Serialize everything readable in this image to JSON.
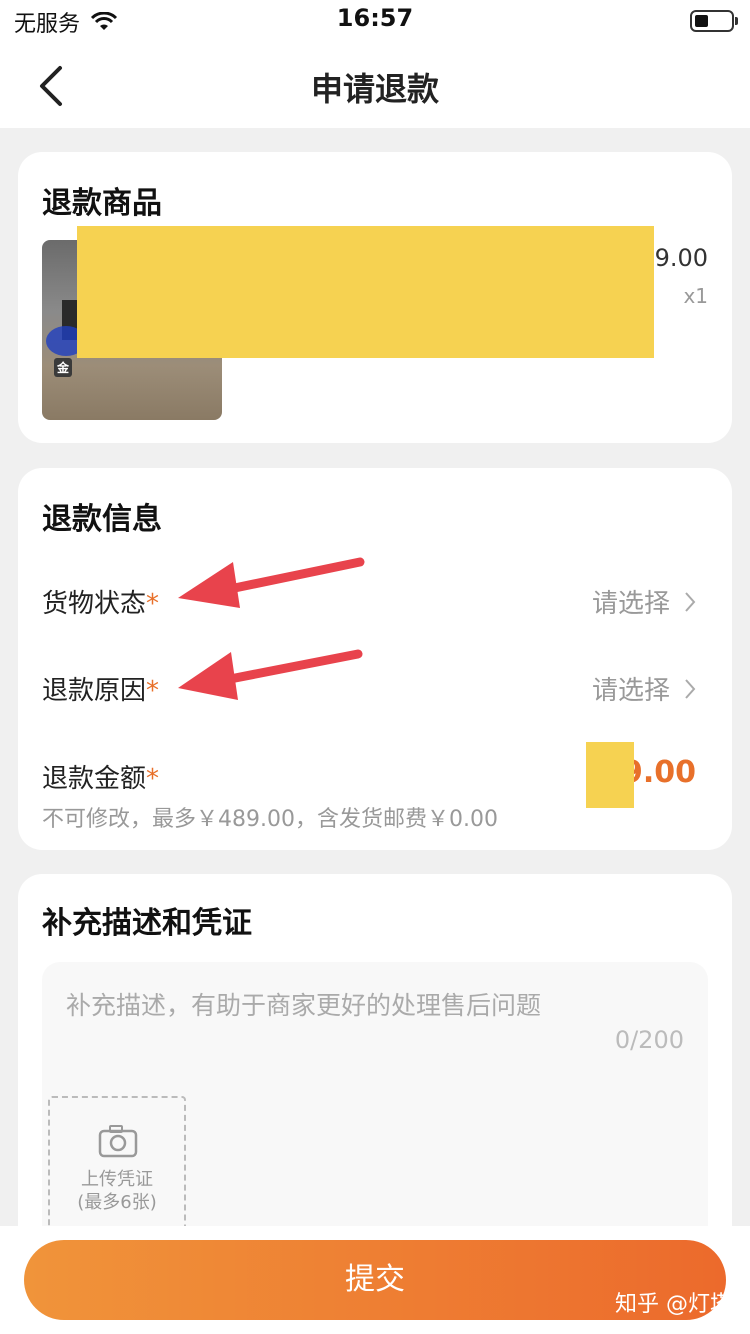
{
  "status_bar": {
    "carrier": "无服务",
    "time": "16:57"
  },
  "nav": {
    "title": "申请退款"
  },
  "product_card": {
    "title": "退款商品",
    "price": "9.00",
    "quantity": "x1"
  },
  "info_card": {
    "title": "退款信息",
    "goods_status": {
      "label": "货物状态",
      "value": "请选择"
    },
    "refund_reason": {
      "label": "退款原因",
      "value": "请选择"
    },
    "refund_amount": {
      "label": "退款金额",
      "amount": "¥    9.00",
      "note": "不可修改，最多￥489.00，含发货邮费￥0.00"
    },
    "required_mark": "*"
  },
  "desc_card": {
    "title": "补充描述和凭证",
    "placeholder": "补充描述，有助于商家更好的处理售后问题",
    "counter": "0/200",
    "upload": {
      "line1": "上传凭证",
      "line2": "(最多6张)"
    }
  },
  "bottom": {
    "submit_label": "提交",
    "watermark": "知乎 @灯塔"
  },
  "colors": {
    "accent": "#e8702a",
    "redaction": "#f6d251",
    "arrow": "#e8434c"
  }
}
